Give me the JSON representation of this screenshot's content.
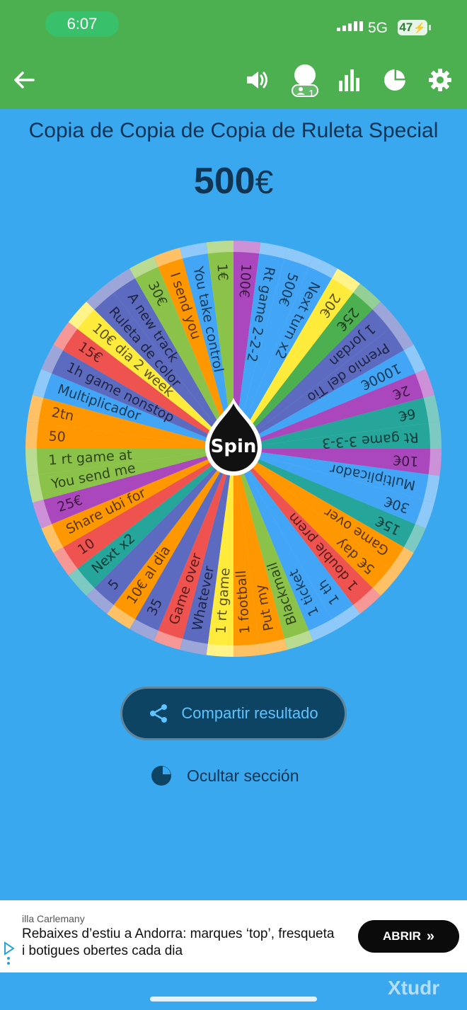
{
  "status_bar": {
    "time": "6:07",
    "network": "5G",
    "battery": "47"
  },
  "toolbar": {
    "back_icon": "arrow-left-icon",
    "sound_icon": "volume-icon",
    "players_icon": "players-icon",
    "players_count": "1",
    "stats_icon": "bar-chart-icon",
    "sections_icon": "pie-chart-icon",
    "settings_icon": "gear-icon"
  },
  "page": {
    "title": "Copia de Copia de Copia de Ruleta Special",
    "amount": "500",
    "currency": "€"
  },
  "wheel": {
    "center_label": "Spin",
    "segments": [
      {
        "label": "100€",
        "color": "#ab47bc"
      },
      {
        "label": "Rt game 2-2-2",
        "color": "#42a5f5"
      },
      {
        "label": "500€",
        "color": "#42a5f5"
      },
      {
        "label": "Next turn x2",
        "color": "#42a5f5"
      },
      {
        "label": "20€",
        "color": "#ffeb3b"
      },
      {
        "label": "25€",
        "color": "#4caf50"
      },
      {
        "label": "1 Jordan",
        "color": "#5c6bc0"
      },
      {
        "label": "Premio del Tio",
        "color": "#5c6bc0"
      },
      {
        "label": "1000€",
        "color": "#42a5f5"
      },
      {
        "label": "2€",
        "color": "#ab47bc"
      },
      {
        "label": "6€",
        "color": "#26a69a"
      },
      {
        "label": "Rt game 3-3-3",
        "color": "#26a69a"
      },
      {
        "label": "10€",
        "color": "#ab47bc"
      },
      {
        "label": "Multiplicador",
        "color": "#42a5f5"
      },
      {
        "label": "30€",
        "color": "#42a5f5"
      },
      {
        "label": "15€",
        "color": "#26a69a"
      },
      {
        "label": "Game over",
        "color": "#ff9800"
      },
      {
        "label": "5€ day",
        "color": "#ff9800"
      },
      {
        "label": "1 double prem",
        "color": "#ef5350"
      },
      {
        "label": "1 th",
        "color": "#42a5f5"
      },
      {
        "label": "1 ticket",
        "color": "#42a5f5"
      },
      {
        "label": "Blackmail",
        "color": "#8bc34a"
      },
      {
        "label": "Put my",
        "color": "#ff9800"
      },
      {
        "label": "1 football",
        "color": "#ff9800"
      },
      {
        "label": "1 rt game",
        "color": "#ffeb3b"
      },
      {
        "label": "Whatever",
        "color": "#5c6bc0"
      },
      {
        "label": "Game over",
        "color": "#ef5350"
      },
      {
        "label": "35",
        "color": "#5c6bc0"
      },
      {
        "label": "10€ al dia",
        "color": "#ff9800"
      },
      {
        "label": "5",
        "color": "#5c6bc0"
      },
      {
        "label": "Next x2",
        "color": "#26a69a"
      },
      {
        "label": "10",
        "color": "#ef5350"
      },
      {
        "label": "Share ubi for",
        "color": "#ff9800"
      },
      {
        "label": "25€",
        "color": "#ab47bc"
      },
      {
        "label": "You send me",
        "color": "#8bc34a"
      },
      {
        "label": "1 rt game at",
        "color": "#8bc34a"
      },
      {
        "label": "50",
        "color": "#ff9800"
      },
      {
        "label": "2tn",
        "color": "#ff9800"
      },
      {
        "label": "Multiplicador",
        "color": "#42a5f5"
      },
      {
        "label": "1h game nonstop",
        "color": "#5c6bc0"
      },
      {
        "label": "15€",
        "color": "#ef5350"
      },
      {
        "label": "10€ dia 2 week",
        "color": "#ffeb3b"
      },
      {
        "label": "Ruleta de color",
        "color": "#5c6bc0"
      },
      {
        "label": "A new track",
        "color": "#5c6bc0"
      },
      {
        "label": "30€",
        "color": "#8bc34a"
      },
      {
        "label": "I send you",
        "color": "#ff9800"
      },
      {
        "label": "You take control",
        "color": "#42a5f5"
      },
      {
        "label": "1€",
        "color": "#8bc34a"
      }
    ]
  },
  "actions": {
    "share_label": "Compartir resultado",
    "share_icon": "share-icon",
    "hide_label": "Ocultar sección",
    "hide_icon": "pie-chart-icon"
  },
  "ad": {
    "source": "illa Carlemany",
    "headline": "Rebaixes d’estiu a Andorra: marques ‘top’, fresqueta i botigues obertes cada dia",
    "button_label": "ABRIR",
    "button_icon": "double-chevron-right-icon",
    "adchoices_icon": "adchoices-icon"
  },
  "watermark": "Xtudr"
}
